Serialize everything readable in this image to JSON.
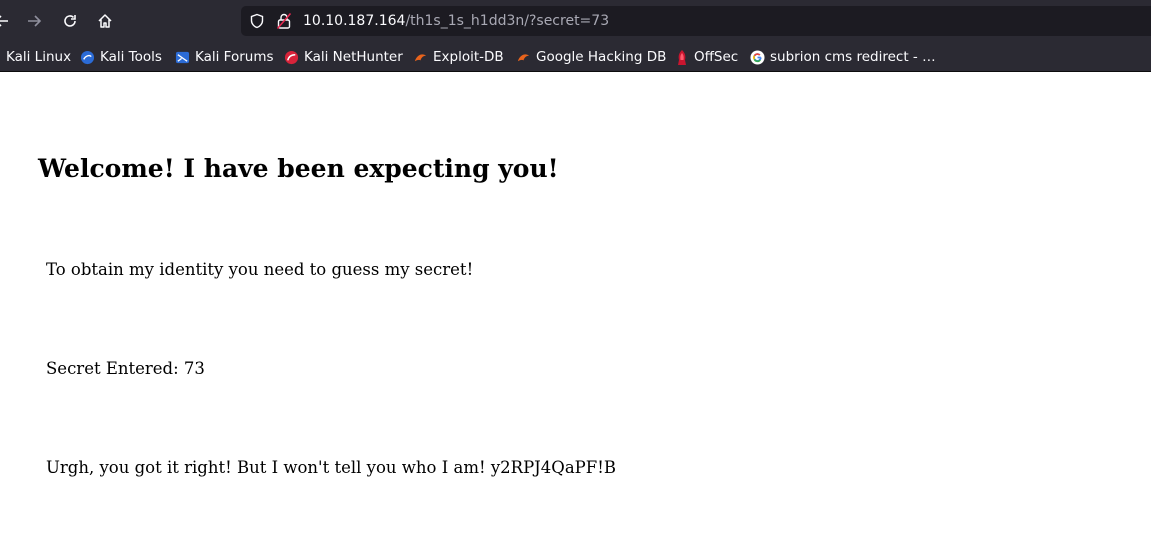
{
  "browser": {
    "url_host": "10.10.187.164",
    "url_path": "/th1s_1s_h1dd3n/?secret=73"
  },
  "bookmarks": [
    {
      "label": "Kali Linux",
      "icon": "kali-icon"
    },
    {
      "label": "Kali Tools",
      "icon": "kali-tools-icon"
    },
    {
      "label": "Kali Forums",
      "icon": "kali-forums-icon"
    },
    {
      "label": "Kali NetHunter",
      "icon": "nethunter-icon"
    },
    {
      "label": "Exploit-DB",
      "icon": "exploit-db-icon"
    },
    {
      "label": "Google Hacking DB",
      "icon": "ghdb-icon"
    },
    {
      "label": "OffSec",
      "icon": "offsec-icon"
    },
    {
      "label": "subrion cms redirect - …",
      "icon": "google-icon"
    }
  ],
  "page": {
    "heading": "Welcome! I have been expecting you!",
    "intro": "To obtain my identity you need to guess my secret!",
    "secret_line": "Secret Entered: 73",
    "result_line": "Urgh, you got it right! But I won't tell you who I am! y2RPJ4QaPF!B"
  }
}
